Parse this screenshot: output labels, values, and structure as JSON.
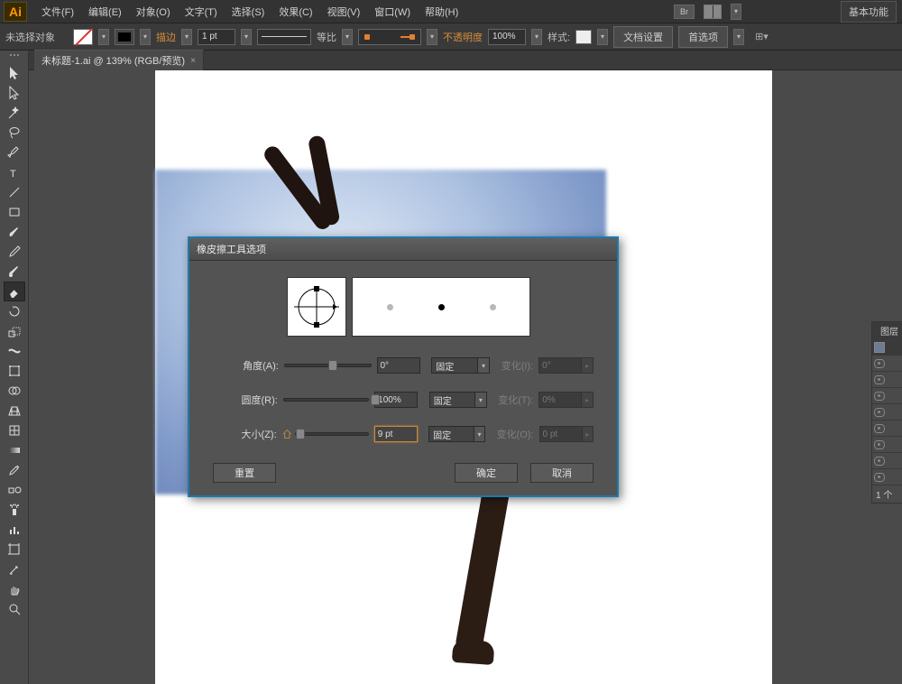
{
  "app": {
    "logo_text": "Ai"
  },
  "menu": {
    "items": [
      "文件(F)",
      "编辑(E)",
      "对象(O)",
      "文字(T)",
      "选择(S)",
      "效果(C)",
      "视图(V)",
      "窗口(W)",
      "帮助(H)"
    ],
    "bridge": "Br",
    "workspace": "基本功能"
  },
  "options": {
    "no_selection": "未选择对象",
    "stroke_label": "描边",
    "stroke_value": "1 pt",
    "scale_label": "等比",
    "opacity_label": "不透明度",
    "opacity_value": "100%",
    "style_label": "样式:",
    "doc_setup": "文档设置",
    "prefs": "首选项"
  },
  "tab": {
    "title": "未标题-1.ai @ 139% (RGB/预览)",
    "close": "×"
  },
  "sidepanel": {
    "title": "图层",
    "footer": "1 个"
  },
  "dialog": {
    "title": "橡皮擦工具选项",
    "angle_label": "角度(A):",
    "angle_value": "0°",
    "round_label": "圆度(R):",
    "round_value": "100%",
    "size_label": "大小(Z):",
    "size_value": "9 pt",
    "fixed": "固定",
    "var_angle_label": "变化(I):",
    "var_angle_value": "0°",
    "var_round_label": "变化(T):",
    "var_round_value": "0%",
    "var_size_label": "变化(O):",
    "var_size_value": "0 pt",
    "reset": "重置",
    "ok": "确定",
    "cancel": "取消"
  }
}
